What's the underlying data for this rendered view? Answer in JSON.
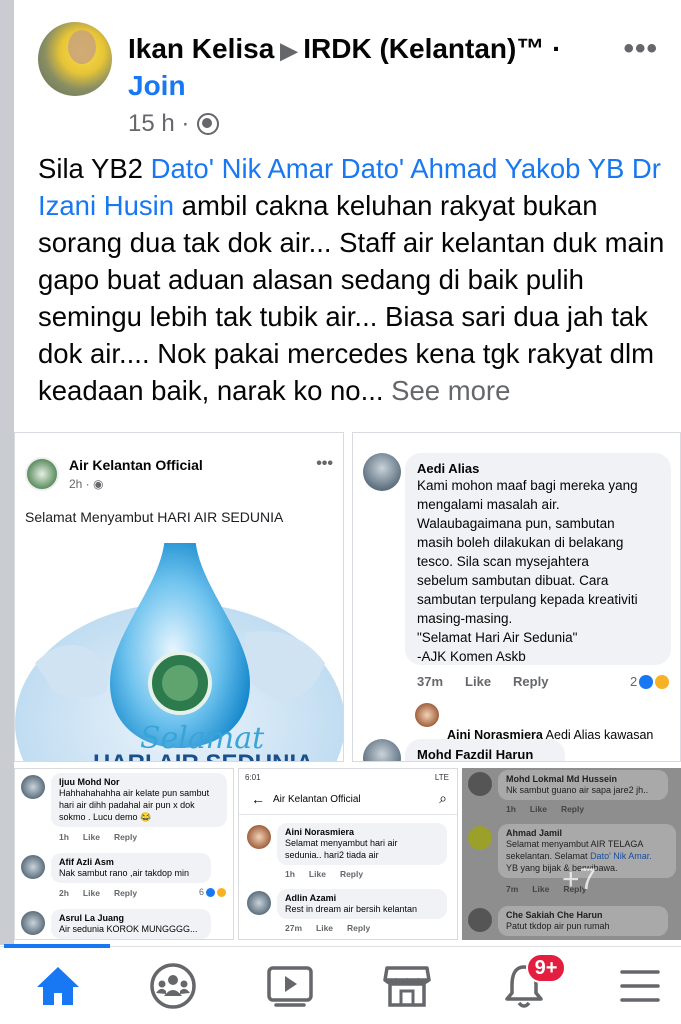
{
  "post": {
    "author": "Ikan Kelisa",
    "group": "IRDK (Kelantan)™ ·",
    "join_label": "Join",
    "time": "15 h ·",
    "more_label": "•••",
    "text_before": "Sila YB2 ",
    "mention": "Dato' Nik Amar Dato' Ahmad Yakob YB Dr Izani Husin",
    "text_after": " ambil cakna keluhan rakyat bukan sorang dua tak dok air... Staff air kelantan duk main gapo buat aduan alasan sedang di baik pulih semingu lebih tak tubik air... Biasa sari dua jah tak dok air.... Nok pakai mercedes kena tgk rakyat dlm keadaan baik, narak ko no...",
    "see_more": "See more"
  },
  "tile1": {
    "page_name": "Air Kelantan Official",
    "meta": "2h ·",
    "dots": "•••",
    "greeting": "Selamat Menyambut HARI AIR SEDUNIA",
    "art_script": "Selamat",
    "art_caption": "HARI AIR SEDUNIA"
  },
  "tile2": {
    "comment": {
      "name": "Aedi Alias",
      "text": "Kami mohon maaf bagi mereka yang\nmengalami masalah air.\nWalaubagaimana pun,  sambutan\nmasih boleh dilakukan di belakang\ntesco.  Sila scan mysejahtera\nsebelum sambutan dibuat. Cara\nsambutan terpulang kepada kreativiti\nmasing-masing.\n\"Selamat Hari Air Sedunia\"\n-AJK Komen Askb",
      "time": "37m",
      "like": "Like",
      "reply": "Reply",
      "reactions": "2"
    },
    "reply": {
      "name": "Aini Norasmiera",
      "text": "Aedi Alias kawasan pa..."
    },
    "next_name": "Mohd Fazdil Harun"
  },
  "tile3": {
    "comments": [
      {
        "name": "Ijuu Mohd Nor",
        "text": "Hahhahahahha air kelate pun sambut\nhari air dihh padahal air pun x dok\nsokmo . Lucu demo 😂",
        "time": "1h",
        "like": "Like",
        "reply": "Reply"
      },
      {
        "name": "Afif Azli Asm",
        "text": "Nak sambut rano ,air takdop min",
        "time": "2h",
        "like": "Like",
        "reply": "Reply",
        "reactions": "6"
      },
      {
        "name": "Asrul La Juang",
        "text": "Air sedunia KOROK MUNGGGG..."
      }
    ]
  },
  "tile4": {
    "status_time": "6:01",
    "status_right": "LTE",
    "title": "Air Kelantan Official",
    "comments": [
      {
        "name": "Aini Norasmiera",
        "text": "Selamat menyambut hari air\nsedunia.. hari2 tiada air",
        "time": "1h",
        "like": "Like",
        "reply": "Reply"
      },
      {
        "name": "Adlin Azami",
        "text": "Rest in dream air bersih kelantan",
        "time": "27m",
        "like": "Like",
        "reply": "Reply"
      }
    ]
  },
  "tile5": {
    "c1": {
      "name": "Mohd Lokmal Md Hussein",
      "text": "Nk sambut guano air sapa jare2 jh..",
      "time": "1h",
      "like": "Like",
      "reply": "Reply"
    },
    "c2": {
      "name": "Ahmad Jamil",
      "text_before": "Selamat menyambut AIR TELAGA\nsekelantan. Selamat ",
      "mention": "Dato' Nik Amar.",
      "text_after": "\nYB yang bijak & berwibawa.",
      "time": "7m",
      "like": "Like",
      "reply": "Reply"
    },
    "c3": {
      "name": "Che Sakiah Che Harun",
      "text": "Patut tkdop air pun rumah"
    },
    "overlay": "+7"
  },
  "nav": {
    "badge": "9+",
    "items": [
      "home-icon",
      "groups-icon",
      "watch-icon",
      "marketplace-icon",
      "notifications-icon",
      "menu-icon"
    ],
    "active_color": "#1877f2"
  }
}
